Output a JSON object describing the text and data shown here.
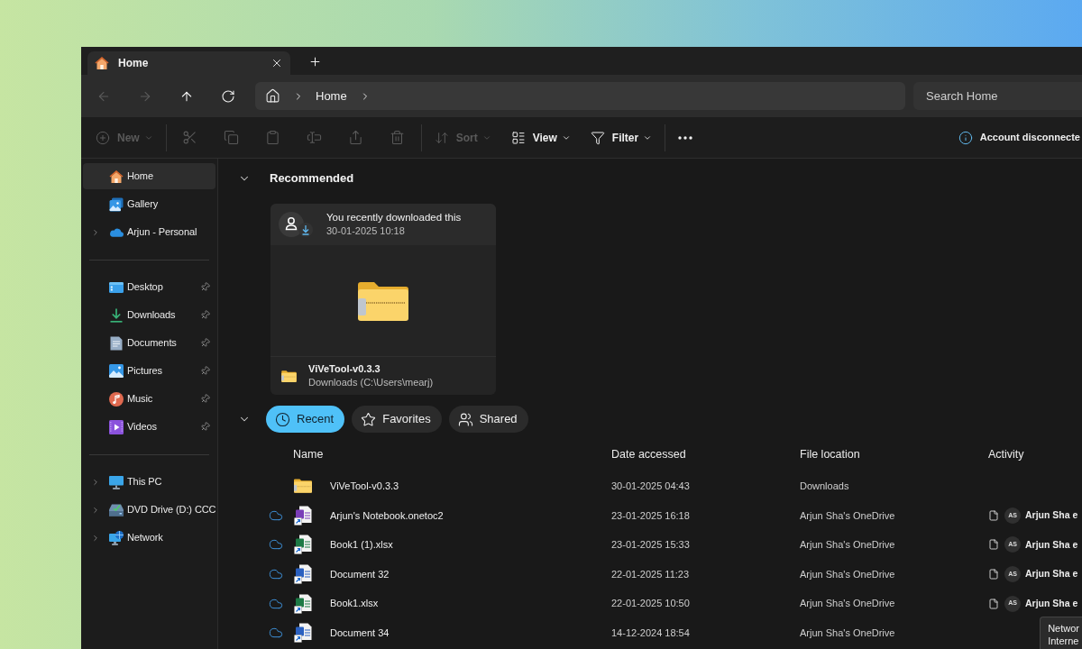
{
  "tabs": [
    {
      "label": "Home",
      "selected": true
    }
  ],
  "navigation": {
    "buttons": [
      {
        "kind": "back",
        "disabled": true
      },
      {
        "kind": "forward",
        "disabled": true
      },
      {
        "kind": "up",
        "disabled": false
      },
      {
        "kind": "refresh",
        "disabled": false
      }
    ],
    "breadcrumbs": [
      "Home"
    ],
    "search": {
      "placeholder": "Search Home"
    }
  },
  "toolbar": {
    "items": [
      {
        "kind": "new",
        "label": "New",
        "disabled": true
      },
      {
        "kind": "separator"
      },
      {
        "kind": "cut",
        "disabled": true
      },
      {
        "kind": "copy",
        "disabled": true
      },
      {
        "kind": "paste",
        "disabled": true
      },
      {
        "kind": "rename",
        "disabled": true
      },
      {
        "kind": "share",
        "disabled": true
      },
      {
        "kind": "delete",
        "disabled": true
      },
      {
        "kind": "separator"
      },
      {
        "kind": "sort",
        "label": "Sort",
        "disabled": true
      },
      {
        "kind": "view",
        "label": "View",
        "disabled": false
      },
      {
        "kind": "filter",
        "label": "Filter",
        "disabled": false
      },
      {
        "kind": "separator"
      },
      {
        "kind": "more",
        "disabled": false
      }
    ],
    "status": "Account disconnecte"
  },
  "sidebar": {
    "sections": [
      {
        "items": [
          {
            "kind": "home",
            "label": "Home",
            "selected": true,
            "expandable": false,
            "pinned": false
          },
          {
            "kind": "gallery",
            "label": "Gallery",
            "selected": false,
            "expandable": false,
            "pinned": false
          },
          {
            "kind": "cloud",
            "label": "Arjun - Personal",
            "selected": false,
            "expandable": true,
            "pinned": false
          }
        ]
      },
      {
        "items": [
          {
            "kind": "desktop",
            "label": "Desktop",
            "selected": false,
            "expandable": false,
            "pinned": true
          },
          {
            "kind": "downloads",
            "label": "Downloads",
            "selected": false,
            "expandable": false,
            "pinned": true
          },
          {
            "kind": "documents",
            "label": "Documents",
            "selected": false,
            "expandable": false,
            "pinned": true
          },
          {
            "kind": "pictures",
            "label": "Pictures",
            "selected": false,
            "expandable": false,
            "pinned": true
          },
          {
            "kind": "music",
            "label": "Music",
            "selected": false,
            "expandable": false,
            "pinned": true
          },
          {
            "kind": "videos",
            "label": "Videos",
            "selected": false,
            "expandable": false,
            "pinned": true
          }
        ]
      },
      {
        "items": [
          {
            "kind": "pc",
            "label": "This PC",
            "selected": false,
            "expandable": true,
            "pinned": false
          },
          {
            "kind": "drive",
            "label": "DVD Drive (D:) CCC",
            "selected": false,
            "expandable": true,
            "pinned": false
          },
          {
            "kind": "network",
            "label": "Network",
            "selected": false,
            "expandable": true,
            "pinned": false
          }
        ]
      }
    ]
  },
  "recommended": {
    "title": "Recommended",
    "expanded": true,
    "cards": [
      {
        "note": "You recently downloaded this",
        "time": "30-01-2025 10:18",
        "name": "ViVeTool-v0.3.3",
        "location": "Downloads (C:\\Users\\mearj)"
      }
    ]
  },
  "files": {
    "expanded": true,
    "filters": [
      {
        "kind": "recent",
        "label": "Recent",
        "selected": true
      },
      {
        "kind": "favorites",
        "label": "Favorites",
        "selected": false
      },
      {
        "kind": "shared",
        "label": "Shared",
        "selected": false
      }
    ],
    "columns": [
      "Name",
      "Date accessed",
      "File location",
      "Activity"
    ],
    "rows": [
      {
        "kind": "folder",
        "name": "ViVeTool-v0.3.3",
        "date": "30-01-2025 04:43",
        "location": "Downloads",
        "online": false
      },
      {
        "kind": "onenote",
        "name": "Arjun's Notebook.onetoc2",
        "date": "23-01-2025 16:18",
        "location": "Arjun Sha's OneDrive",
        "online": true,
        "activity": {
          "initials": "AS",
          "text": "Arjun Sha e"
        }
      },
      {
        "kind": "excel",
        "name": "Book1 (1).xlsx",
        "date": "23-01-2025 15:33",
        "location": "Arjun Sha's OneDrive",
        "online": true,
        "activity": {
          "initials": "AS",
          "text": "Arjun Sha e"
        }
      },
      {
        "kind": "word",
        "name": "Document 32",
        "date": "22-01-2025 11:23",
        "location": "Arjun Sha's OneDrive",
        "online": true,
        "activity": {
          "initials": "AS",
          "text": "Arjun Sha e"
        }
      },
      {
        "kind": "excel",
        "name": "Book1.xlsx",
        "date": "22-01-2025 10:50",
        "location": "Arjun Sha's OneDrive",
        "online": true,
        "activity": {
          "initials": "AS",
          "text": "Arjun Sha e"
        }
      },
      {
        "kind": "word",
        "name": "Document 34",
        "date": "14-12-2024 18:54",
        "location": "Arjun Sha's OneDrive",
        "online": true
      }
    ]
  },
  "tooltip": {
    "lines": [
      "Networ",
      "Interne"
    ]
  }
}
